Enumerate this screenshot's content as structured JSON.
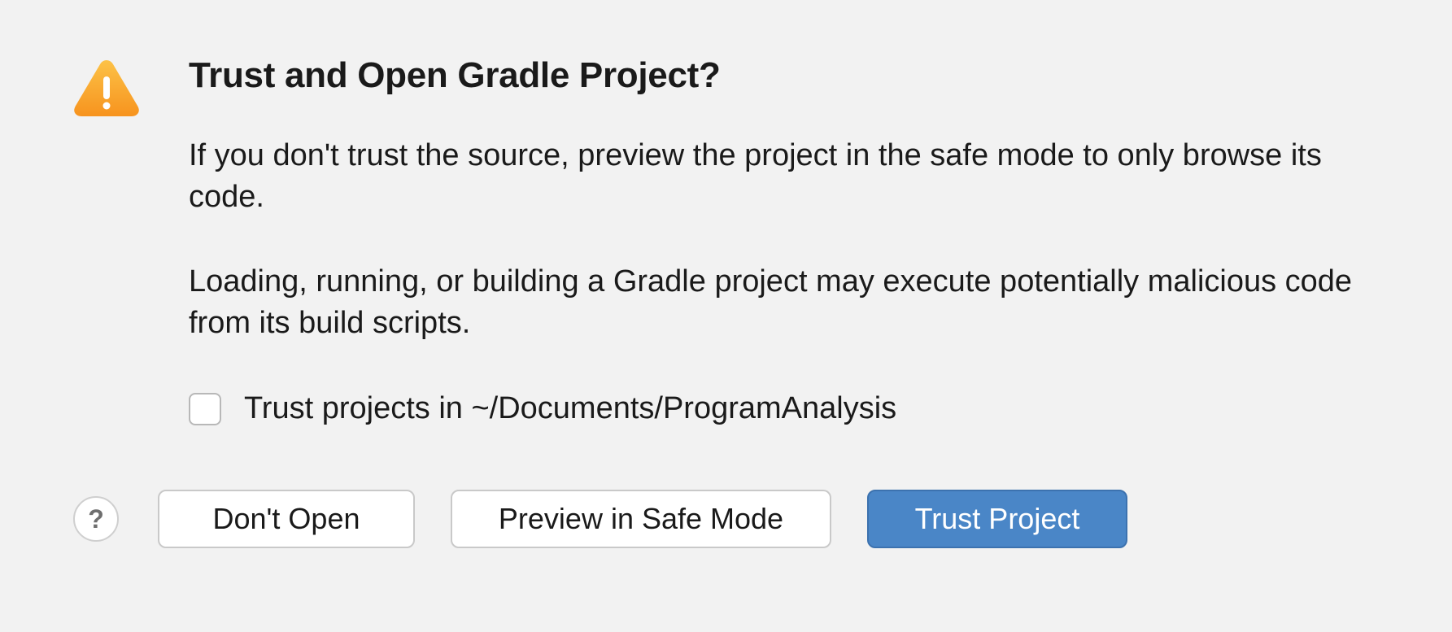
{
  "dialog": {
    "title": "Trust and Open Gradle Project?",
    "paragraph1": "If you don't trust the source, preview the project in the safe mode to only browse its code.",
    "paragraph2": "Loading, running, or building a Gradle project may execute potentially malicious code from its build scripts.",
    "checkbox_label": "Trust projects in ~/Documents/ProgramAnalysis",
    "checkbox_checked": false
  },
  "buttons": {
    "help": "?",
    "dont_open": "Don't Open",
    "preview_safe": "Preview in Safe Mode",
    "trust_project": "Trust Project"
  },
  "colors": {
    "warning_top": "#fbb03b",
    "warning_bottom": "#f7931e",
    "primary_btn": "#4a86c7"
  }
}
